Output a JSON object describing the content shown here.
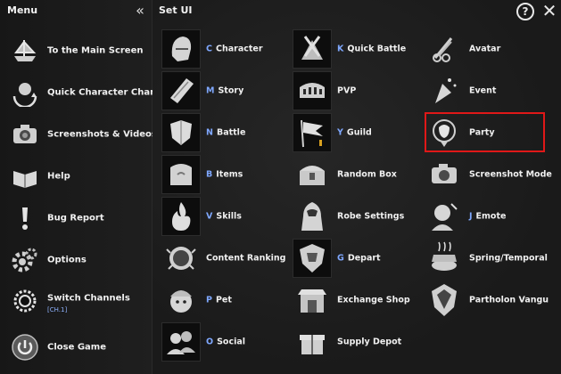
{
  "left_menu": {
    "title": "Menu",
    "collapse_glyph": "«",
    "items": [
      {
        "label": "To the Main Screen",
        "icon": "ship-icon"
      },
      {
        "label": "Quick Character Change",
        "icon": "character-swap-icon"
      },
      {
        "label": "Screenshots & Videos",
        "icon": "camera-icon"
      },
      {
        "label": "Help",
        "icon": "book-icon"
      },
      {
        "label": "Bug Report",
        "icon": "exclamation-icon"
      },
      {
        "label": "Options",
        "icon": "gears-icon"
      },
      {
        "label": "Switch Channels",
        "sub": "[CH.1]",
        "icon": "channel-icon"
      },
      {
        "label": "Close Game",
        "icon": "power-icon"
      }
    ]
  },
  "set_ui": {
    "title": "Set UI",
    "help_glyph": "?",
    "close_glyph": "✕",
    "items": [
      {
        "hotkey": "C",
        "label": "Character",
        "icon": "helmet-icon"
      },
      {
        "hotkey": "K",
        "label": "Quick Battle",
        "icon": "quick-battle-icon"
      },
      {
        "hotkey": "",
        "label": "Avatar",
        "icon": "avatar-icon"
      },
      {
        "hotkey": "M",
        "label": "Story",
        "icon": "scroll-icon"
      },
      {
        "hotkey": "",
        "label": "PVP",
        "icon": "colosseum-icon"
      },
      {
        "hotkey": "",
        "label": "Event",
        "icon": "party-popper-icon"
      },
      {
        "hotkey": "N",
        "label": "Battle",
        "icon": "shield-icon"
      },
      {
        "hotkey": "Y",
        "label": "Guild",
        "icon": "flag-icon"
      },
      {
        "hotkey": "",
        "label": "Party",
        "icon": "party-icon"
      },
      {
        "hotkey": "B",
        "label": "Items",
        "icon": "bag-icon"
      },
      {
        "hotkey": "",
        "label": "Random Box",
        "icon": "chest-icon"
      },
      {
        "hotkey": "",
        "label": "Screenshot Mode",
        "icon": "camera-icon"
      },
      {
        "hotkey": "V",
        "label": "Skills",
        "icon": "flame-icon"
      },
      {
        "hotkey": "",
        "label": "Robe Settings",
        "icon": "robe-icon"
      },
      {
        "hotkey": "J",
        "label": "Emote",
        "icon": "emote-icon"
      },
      {
        "hotkey": "",
        "label": "Content Ranking",
        "icon": "ranking-icon"
      },
      {
        "hotkey": "G",
        "label": "Depart",
        "icon": "depart-shield-icon"
      },
      {
        "hotkey": "",
        "label": "Spring/Temporal",
        "icon": "spring-icon"
      },
      {
        "hotkey": "P",
        "label": "Pet",
        "icon": "pet-icon"
      },
      {
        "hotkey": "",
        "label": "Exchange Shop",
        "icon": "shop-icon"
      },
      {
        "hotkey": "",
        "label": "Partholon Vangu",
        "icon": "vanguard-icon"
      },
      {
        "hotkey": "O",
        "label": "Social",
        "icon": "social-icon"
      },
      {
        "hotkey": "",
        "label": "Supply Depot",
        "icon": "gift-icon"
      }
    ]
  }
}
